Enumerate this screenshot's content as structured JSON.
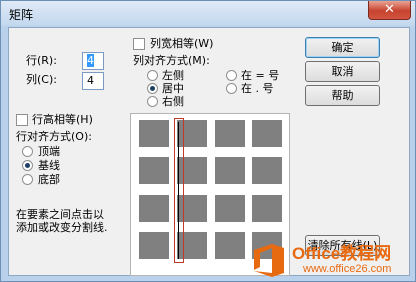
{
  "window": {
    "title": "矩阵",
    "close_glyph": "✕"
  },
  "rows_field": {
    "label": "行(R):",
    "value": "4"
  },
  "cols_field": {
    "label": "列(C):",
    "value": "4"
  },
  "equal_col_width": {
    "label": "列宽相等(W)",
    "checked": false
  },
  "col_align": {
    "label": "列对齐方式(M):",
    "options": [
      {
        "label": "左侧",
        "selected": false
      },
      {
        "label": "居中",
        "selected": true
      },
      {
        "label": "右侧",
        "selected": false
      },
      {
        "label": "在 = 号",
        "selected": false
      },
      {
        "label": "在 . 号",
        "selected": false
      }
    ]
  },
  "equal_row_height": {
    "label": "行高相等(H)",
    "checked": false
  },
  "row_align": {
    "label": "行对齐方式(O):",
    "options": [
      {
        "label": "顶端",
        "selected": false
      },
      {
        "label": "基线",
        "selected": true
      },
      {
        "label": "底部",
        "selected": false
      }
    ]
  },
  "hint": {
    "line1": "在要素之间点击以",
    "line2": "添加或改变分割线."
  },
  "buttons": {
    "ok": "确定",
    "cancel": "取消",
    "help": "帮助",
    "clear": "清除所有线(L)"
  },
  "preview": {
    "rows": 4,
    "cols": 4,
    "selected_column_divider": 1
  },
  "watermark": {
    "brand": "Office教程网",
    "url": "www.office26.com",
    "accent": "#e86a10"
  },
  "colors": {
    "titlebar": "#c2d7ee",
    "client": "#f0f0f0",
    "cell": "#808080",
    "marker": "#c0392b"
  }
}
